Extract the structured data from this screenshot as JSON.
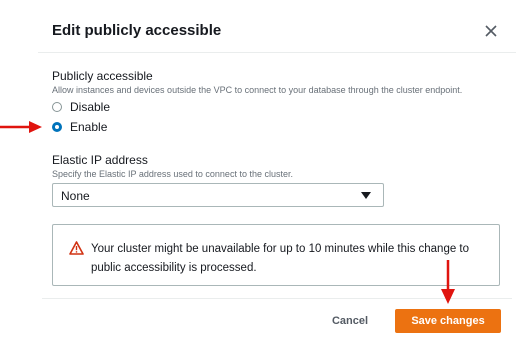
{
  "modal": {
    "title": "Edit publicly accessible"
  },
  "public_access": {
    "label": "Publicly accessible",
    "description": "Allow instances and devices outside the VPC to connect to your database through the cluster endpoint.",
    "options": [
      {
        "label": "Disable",
        "selected": false
      },
      {
        "label": "Enable",
        "selected": true
      }
    ]
  },
  "elastic_ip": {
    "label": "Elastic IP address",
    "description": "Specify the Elastic IP address used to connect to the cluster.",
    "selected_value": "None"
  },
  "alert": {
    "text": "Your cluster might be unavailable for up to 10 minutes while this change to public accessibility is processed.",
    "icon": "warning-icon"
  },
  "footer": {
    "cancel_label": "Cancel",
    "save_label": "Save changes"
  },
  "colors": {
    "primary_button": "#ec7211",
    "radio_selected": "#0073bb",
    "warning": "#d13212",
    "annotation_arrow": "#e0140f"
  }
}
